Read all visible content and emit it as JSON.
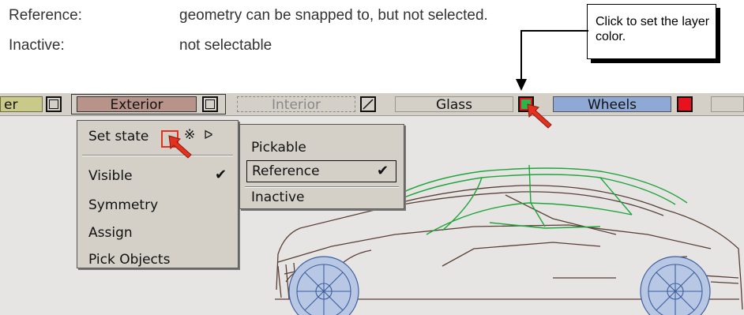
{
  "descriptions": [
    {
      "term": "Reference:",
      "definition": "geometry can be snapped to, but not selected."
    },
    {
      "term": "Inactive:",
      "definition": "not selectable"
    }
  ],
  "callout": {
    "text": "Click to set the layer color."
  },
  "layers": [
    {
      "name": "er",
      "color": "#c9c98a"
    },
    {
      "name": "Exterior",
      "color": "#b8938a"
    },
    {
      "name": "Interior",
      "color": "#d4d0c8"
    },
    {
      "name": "Glass",
      "color": "#d4d0c8",
      "swatch": "#2db54a"
    },
    {
      "name": "Wheels",
      "color": "#8fa9d6",
      "swatch": "#e8121e"
    }
  ],
  "layer_menu": {
    "set_state": "Set state",
    "items": [
      "Visible",
      "Symmetry",
      "Assign",
      "Pick Objects"
    ]
  },
  "state_menu": {
    "items": [
      "Pickable",
      "Reference",
      "Inactive"
    ],
    "checked": "Reference"
  },
  "icons": [
    "sparkle-icon",
    "submenu-arrow-icon",
    "checkmark-icon",
    "red-arrow-pointer-icon"
  ]
}
